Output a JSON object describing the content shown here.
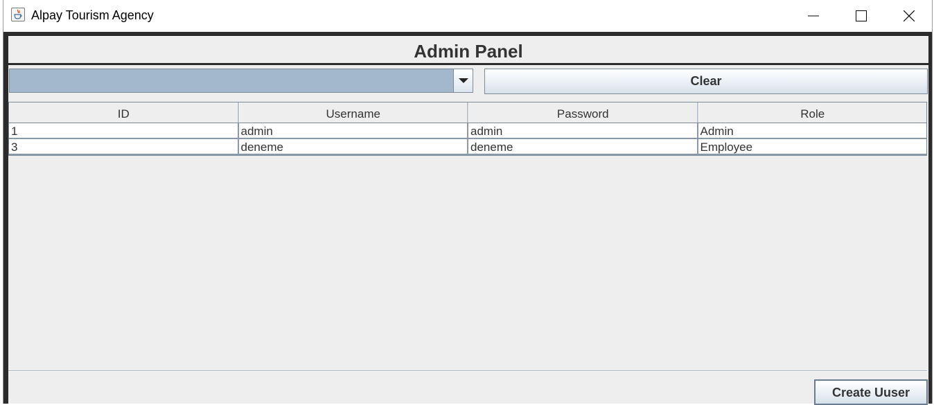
{
  "window": {
    "title": "Alpay Tourism Agency"
  },
  "panel": {
    "title": "Admin Panel"
  },
  "filter": {
    "selected_value": "",
    "clear_label": "Clear"
  },
  "table": {
    "columns": [
      "ID",
      "Username",
      "Password",
      "Role"
    ],
    "rows": [
      [
        "1",
        "admin",
        "admin",
        "Admin"
      ],
      [
        "3",
        "deneme",
        "deneme",
        "Employee"
      ]
    ]
  },
  "footer": {
    "create_label": "Create Uuser"
  },
  "colors": {
    "combo_bg": "#a3b8cc",
    "frame_border": "#2b2b2b",
    "panel_bg": "#eeeeee"
  }
}
